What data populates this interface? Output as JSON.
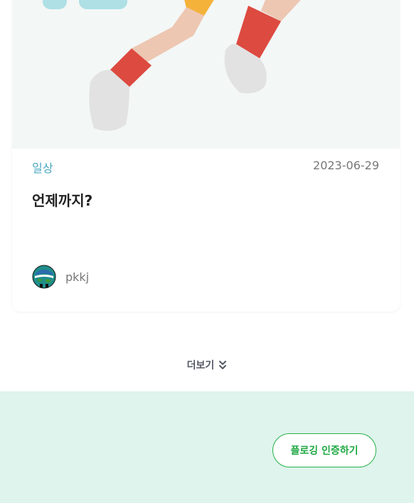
{
  "post": {
    "category": "일상",
    "date": "2023-06-29",
    "title": "언제까지?",
    "author": "pkkj"
  },
  "more": {
    "label": "더보기",
    "icon": "double-chevron-down-icon"
  },
  "footer": {
    "cta_label": "플로깅 인증하기"
  },
  "colors": {
    "accent_green": "#1ea742",
    "footer_bg": "#def4ec",
    "category_blue": "#4aa7c0"
  }
}
